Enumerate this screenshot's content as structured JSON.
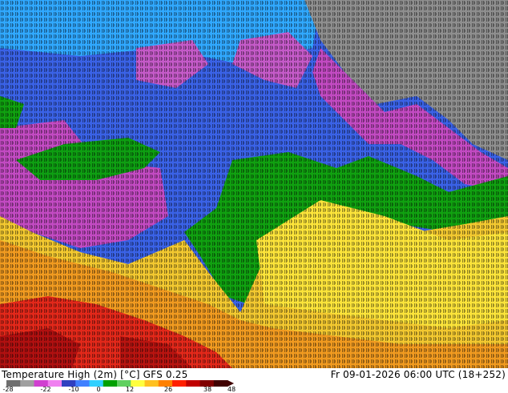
{
  "map": {
    "title": "Temperature High (2m) [°C] GFS 0.25",
    "timestamp": "Fr 09-01-2026 06:00 UTC (18+252)"
  },
  "legend": {
    "ticks": [
      "-28",
      "-22",
      "-10",
      "0",
      "12",
      "26",
      "38",
      "48"
    ],
    "colors": [
      "#6e6e6e",
      "#a0a0a0",
      "#d040d0",
      "#f080f0",
      "#3040c0",
      "#4080ff",
      "#30d0ff",
      "#00a000",
      "#60d060",
      "#ffff40",
      "#ffc020",
      "#ff8000",
      "#ff2000",
      "#c00000",
      "#800000",
      "#400000"
    ]
  },
  "regions": {
    "cold_northeast": "#8a8a8a",
    "magenta": "#c050c0",
    "blue": "#3a5fe0",
    "cyan": "#30b0ff",
    "green": "#10a010",
    "yellow": "#f0d020",
    "orange": "#f0a020",
    "red": "#e02010"
  }
}
